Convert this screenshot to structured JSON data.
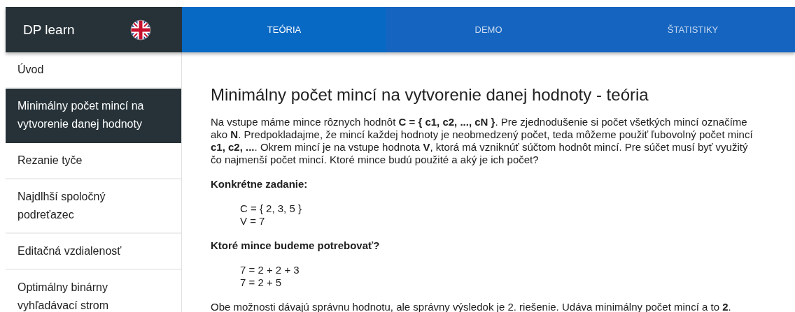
{
  "app": {
    "title": "DP learn"
  },
  "tabs": [
    {
      "label": "TEÓRIA",
      "selected": true
    },
    {
      "label": "DEMO",
      "selected": false
    },
    {
      "label": "ŠTATISTIKY",
      "selected": false
    }
  ],
  "sidebar": {
    "items": [
      {
        "label": "Úvod",
        "selected": false
      },
      {
        "label": "Minimálny počet mincí na vytvorenie danej hodnoty",
        "selected": true
      },
      {
        "label": "Rezanie tyče",
        "selected": false
      },
      {
        "label": "Najdlhší spoločný podreťazec",
        "selected": false
      },
      {
        "label": "Editačná vzdialenosť",
        "selected": false
      },
      {
        "label": "Optimálny binárny vyhľadávací strom",
        "selected": false
      }
    ]
  },
  "content": {
    "heading": "Minimálny počet mincí na vytvorenie danej hodnoty - teória",
    "blocks": [
      {
        "kind": "paragraph",
        "text": "Na vstupe máme mince rôznych hodnôt **C = { c1, c2, ..., cN }**. Pre zjednodušenie si počet všetkých mincí označíme ako **N**. Predpokladajme, že mincí každej hodnoty je neobmedzený počet, teda môžeme použiť ľubovolný počet mincí **c1, c2, ...**. Okrem mincí je na vstupe hodnota **V**, ktorá má vzniknúť súčtom hodnôt mincí. Pre súčet musí byť využitý čo najmenší počet mincí. Ktoré mince budú použité a aký je ich počet?"
      },
      {
        "kind": "subheading",
        "text": "Konkrétne zadanie:"
      },
      {
        "kind": "formula",
        "lines": [
          "C = { 2, 3, 5 }",
          "V = 7"
        ]
      },
      {
        "kind": "subheading",
        "text": "Ktoré mince budeme potrebovať?"
      },
      {
        "kind": "formula",
        "lines": [
          "7 = 2 + 2 + 3",
          "7 = 2 + 5"
        ]
      },
      {
        "kind": "paragraph",
        "text": "Obe možnosti dávajú správnu hodnotu, ale správny výsledok je 2. riešenie. Udáva minimálny počet mincí a to **2**."
      }
    ]
  }
}
